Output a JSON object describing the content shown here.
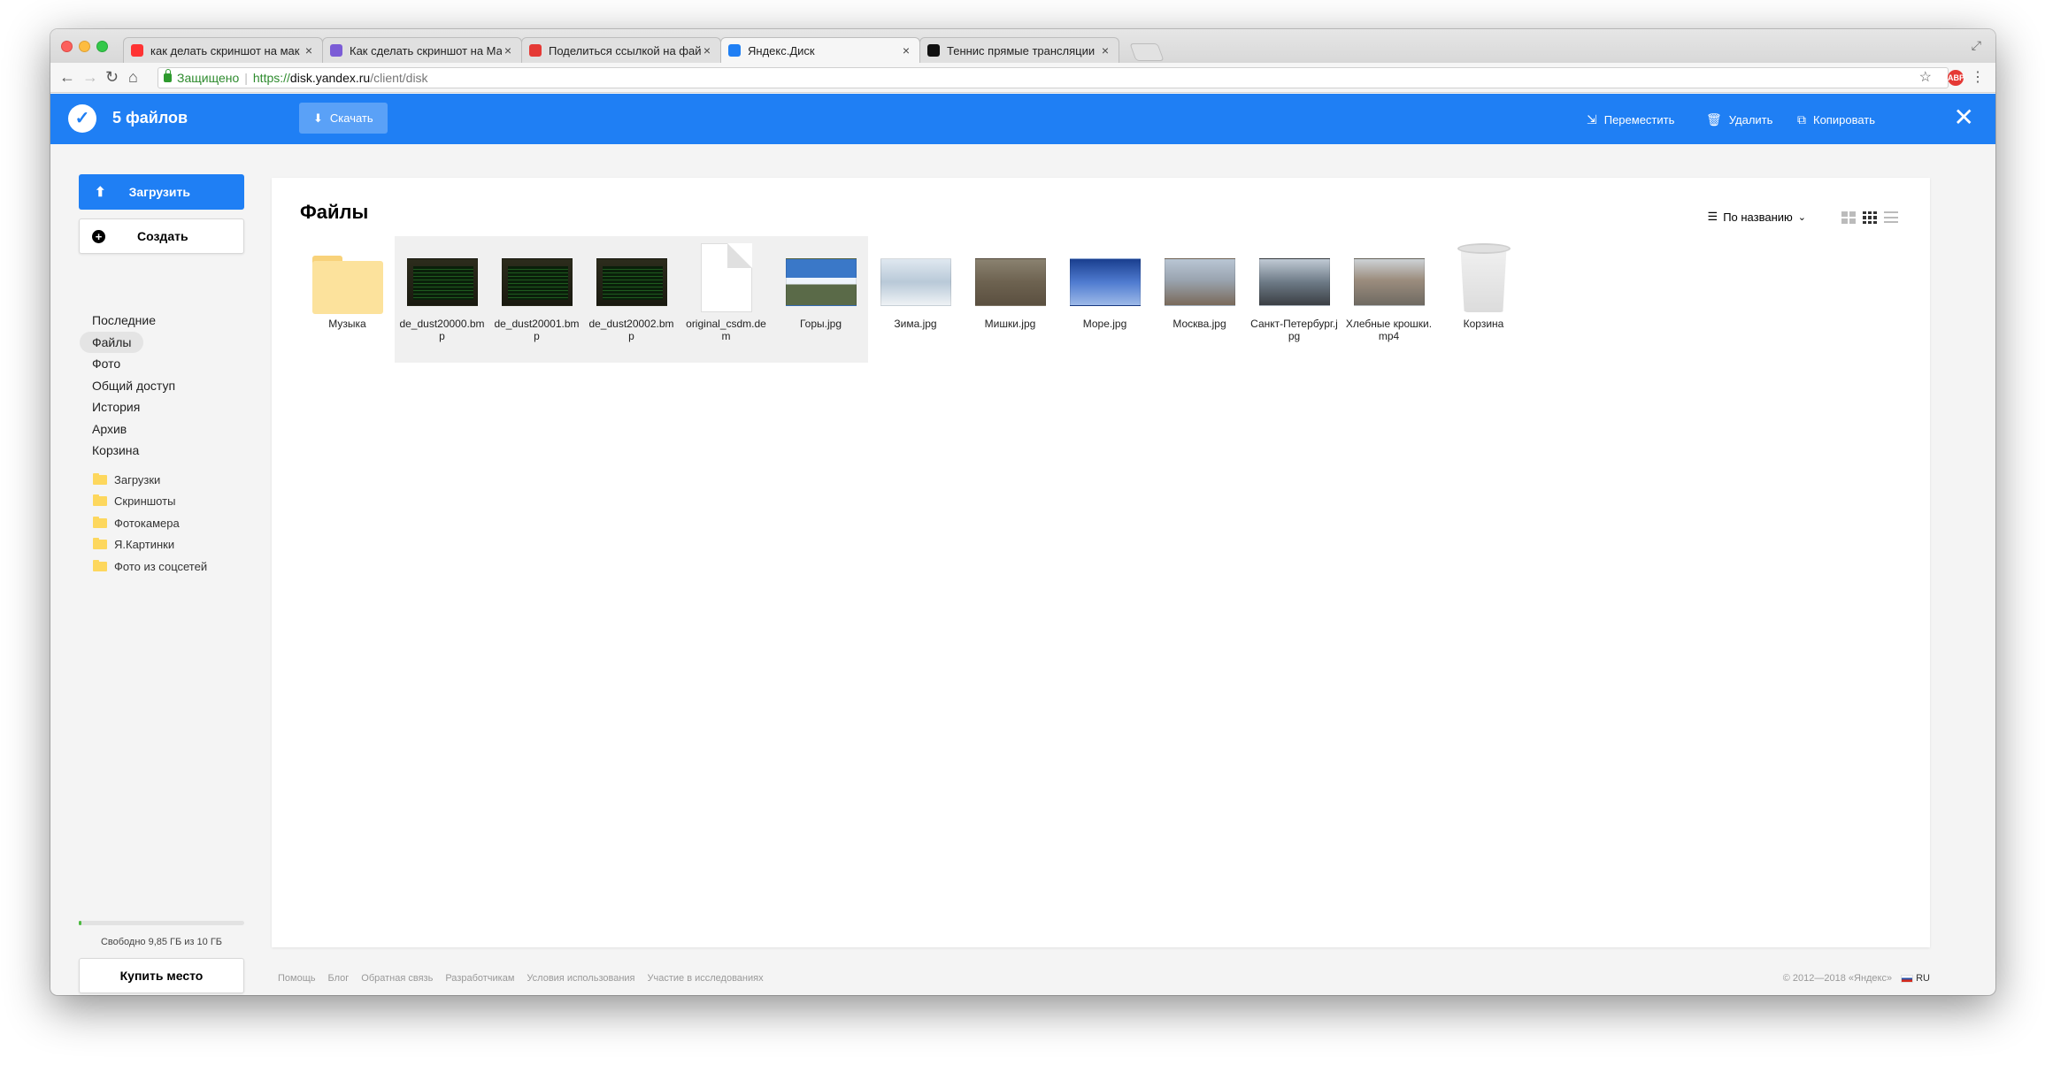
{
  "browser": {
    "tabs": [
      {
        "title": "как делать скриншот на мак",
        "favicon": "yandex-icon",
        "color": "#ff3333"
      },
      {
        "title": "Как сделать скриншот на Ма",
        "favicon": "tg-icon",
        "color": "#7b5cd6"
      },
      {
        "title": "Поделиться ссылкой на фай",
        "favicon": "tv-icon",
        "color": "#e53935"
      },
      {
        "title": "Яндекс.Диск",
        "favicon": "disk-icon",
        "color": "#1f7ff4"
      },
      {
        "title": "Теннис прямые трансляции",
        "favicon": "s-icon",
        "color": "#111111"
      }
    ],
    "active_tab": 3,
    "secure_label": "Защищено",
    "url_proto": "https://",
    "url_host": "disk.yandex.ru",
    "url_path": "/client/disk"
  },
  "header": {
    "count_label": "5 файлов",
    "download_label": "Скачать",
    "move_label": "Переместить",
    "delete_label": "Удалить",
    "copy_label": "Копировать",
    "accent": "#1f7ff4"
  },
  "sidebar": {
    "upload_label": "Загрузить",
    "create_label": "Создать",
    "nav": [
      "Последние",
      "Файлы",
      "Фото",
      "Общий доступ",
      "История",
      "Архив",
      "Корзина"
    ],
    "active_nav": 1,
    "folders": [
      "Загрузки",
      "Скриншоты",
      "Фотокамера",
      "Я.Картинки",
      "Фото из соцсетей"
    ],
    "quota_text": "Свободно 9,85 ГБ из 10 ГБ",
    "quota_used_fraction": 0.015,
    "buy_label": "Купить место"
  },
  "main": {
    "title": "Файлы",
    "sort_label": "По названию",
    "files": [
      {
        "name": "Музыка",
        "kind": "folder",
        "selected": false
      },
      {
        "name": "de_dust20000.bmp",
        "kind": "dust",
        "selected": true
      },
      {
        "name": "de_dust20001.bmp",
        "kind": "dust",
        "selected": true
      },
      {
        "name": "de_dust20002.bmp",
        "kind": "dust",
        "selected": true
      },
      {
        "name": "original_csdm.dem",
        "kind": "doc",
        "selected": true
      },
      {
        "name": "Горы.jpg",
        "kind": "mountains",
        "selected": true
      },
      {
        "name": "Зима.jpg",
        "kind": "winter",
        "selected": false
      },
      {
        "name": "Мишки.jpg",
        "kind": "bears",
        "selected": false
      },
      {
        "name": "Море.jpg",
        "kind": "sea",
        "selected": false
      },
      {
        "name": "Москва.jpg",
        "kind": "moscow",
        "selected": false
      },
      {
        "name": "Санкт-Петербург.jpg",
        "kind": "spb",
        "selected": false
      },
      {
        "name": "Хлебные крошки.mp4",
        "kind": "crumbs",
        "selected": false
      },
      {
        "name": "Корзина",
        "kind": "trash",
        "selected": false
      }
    ]
  },
  "footer": {
    "links": [
      "Помощь",
      "Блог",
      "Обратная связь",
      "Разработчикам",
      "Условия использования",
      "Участие в исследованиях"
    ],
    "copyright": "© 2012—2018 «Яндекс»",
    "lang": "RU"
  }
}
